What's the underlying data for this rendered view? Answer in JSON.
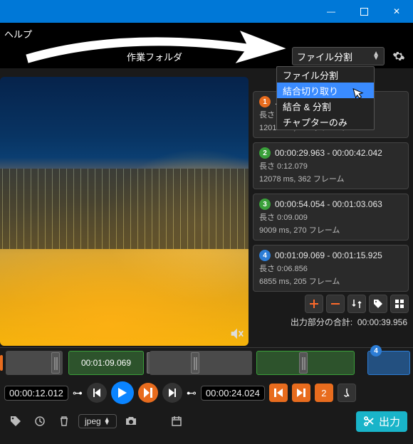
{
  "titlebar": {
    "min": "—",
    "max": "▢",
    "close": "✕"
  },
  "menu": {
    "help": "ヘルプ"
  },
  "toolbar": {
    "workfolder_label": "作業フォルダ",
    "mode_selected": "ファイル分割",
    "mode_options": [
      "ファイル分割",
      "結合切り取り",
      "結合 & 分割",
      "チャプターのみ"
    ]
  },
  "segments": [
    {
      "num": "1",
      "range": "... 24",
      "len": "長さ 0:12.012",
      "detail": "12012 ms, 360 フレーム"
    },
    {
      "num": "2",
      "range": "00:00:29.963 - 00:00:42.042",
      "len": "長さ 0:12.079",
      "detail": "12078 ms, 362 フレーム"
    },
    {
      "num": "3",
      "range": "00:00:54.054 - 00:01:03.063",
      "len": "長さ 0:09.009",
      "detail": "9009 ms, 270 フレーム"
    },
    {
      "num": "4",
      "range": "00:01:09.069 - 00:01:15.925",
      "len": "長さ 0:06.856",
      "detail": "6855 ms, 205 フレーム"
    }
  ],
  "totals": {
    "label": "出力部分の合計:",
    "value": "00:00:39.956"
  },
  "timeline": {
    "green_label": "00:01:09.069"
  },
  "transport": {
    "left_tc": "00:00:12.012",
    "right_tc": "00:00:24.024",
    "badge2": "2"
  },
  "bottom": {
    "format": "jpeg",
    "export": "出力"
  }
}
